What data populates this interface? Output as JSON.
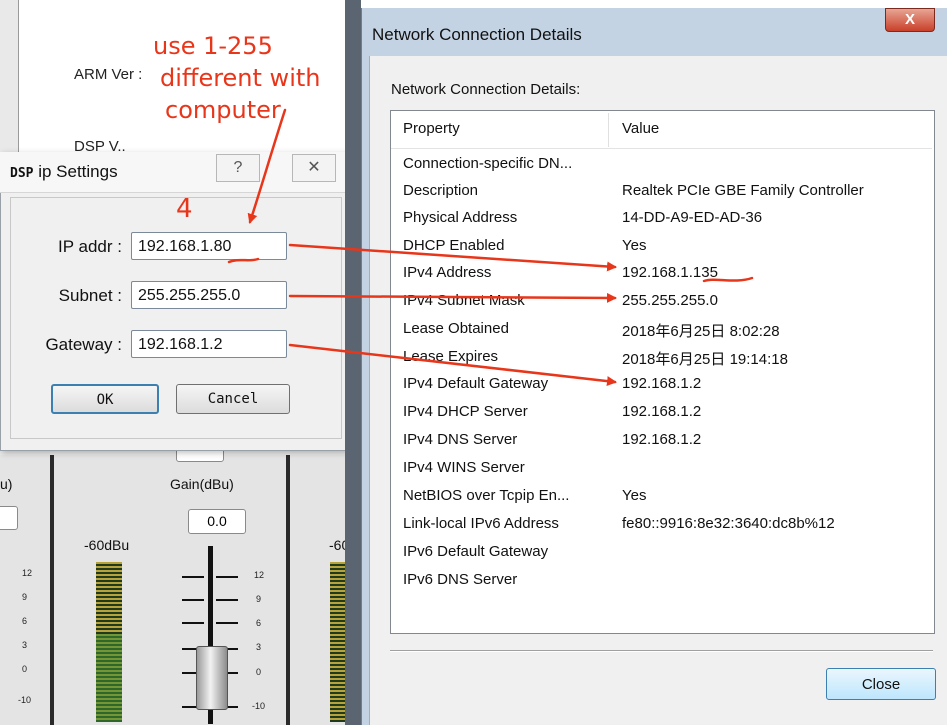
{
  "background_app": {
    "arm_ver_label": "ARM Ver :",
    "dsp_ver_label": "DSP V..",
    "gain_label": "Gain(dBu)",
    "left_partial_label": "u)",
    "gain_value": "0.0",
    "level_left": "-60dBu",
    "level_right": "-60",
    "scale": [
      "12",
      "9",
      "6",
      "3",
      "0",
      "-10"
    ]
  },
  "ip_dialog": {
    "title_bold": "DSP",
    "title_rest": " ip Settings",
    "help_glyph": "?",
    "close_glyph": "✕",
    "ip_label": "IP addr :",
    "ip_value": "192.168.1.80",
    "subnet_label": "Subnet :",
    "subnet_value": "255.255.255.0",
    "gateway_label": "Gateway :",
    "gateway_value": "192.168.1.2",
    "ok_label": "OK",
    "cancel_label": "Cancel"
  },
  "details_window": {
    "title": "Network Connection Details",
    "close_x": "X",
    "list_label": "Network Connection Details:",
    "col_property": "Property",
    "col_value": "Value",
    "rows": [
      {
        "property": "Connection-specific DN...",
        "value": ""
      },
      {
        "property": "Description",
        "value": "Realtek PCIe GBE Family Controller"
      },
      {
        "property": "Physical Address",
        "value": "14-DD-A9-ED-AD-36"
      },
      {
        "property": "DHCP Enabled",
        "value": "Yes"
      },
      {
        "property": "IPv4 Address",
        "value": "192.168.1.135"
      },
      {
        "property": "IPv4 Subnet Mask",
        "value": "255.255.255.0"
      },
      {
        "property": "Lease Obtained",
        "value": "2018年6月25日 8:02:28"
      },
      {
        "property": "Lease Expires",
        "value": "2018年6月25日 19:14:18"
      },
      {
        "property": "IPv4 Default Gateway",
        "value": "192.168.1.2"
      },
      {
        "property": "IPv4 DHCP Server",
        "value": "192.168.1.2"
      },
      {
        "property": "IPv4 DNS Server",
        "value": "192.168.1.2"
      },
      {
        "property": "IPv4 WINS Server",
        "value": ""
      },
      {
        "property": "NetBIOS over Tcpip En...",
        "value": "Yes"
      },
      {
        "property": "Link-local IPv6 Address",
        "value": "fe80::9916:8e32:3640:dc8b%12"
      },
      {
        "property": "IPv6 Default Gateway",
        "value": ""
      },
      {
        "property": "IPv6 DNS Server",
        "value": ""
      }
    ],
    "close_label": "Close"
  },
  "annotations": {
    "line1": "use 1-255",
    "line2": "different with",
    "line3": "computer",
    "step": "4",
    "color": "#e8361b"
  }
}
